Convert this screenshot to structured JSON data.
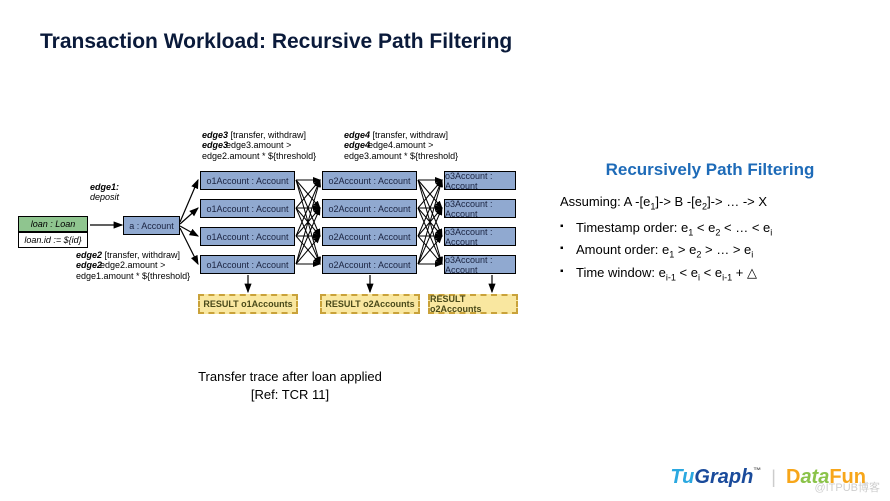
{
  "title": "Transaction Workload: Recursive Path Filtering",
  "diagram": {
    "loan": {
      "header": "loan : Loan",
      "value": "loan.id := ${id}"
    },
    "rootAccount": "a : Account",
    "col1": [
      "o1Account : Account",
      "o1Account : Account",
      "o1Account : Account",
      "o1Account : Account"
    ],
    "col2": [
      "o2Account : Account",
      "o2Account : Account",
      "o2Account : Account",
      "o2Account : Account"
    ],
    "col3": [
      "o3Account : Account",
      "o3Account : Account",
      "o3Account : Account",
      "o3Account : Account"
    ],
    "results": [
      "RESULT o1Accounts",
      "RESULT o2Accounts",
      "RESULT o2Accounts"
    ],
    "edge1": {
      "name": "edge1:",
      "desc": "deposit"
    },
    "edge2": {
      "name": "edge2",
      "desc1": "[transfer, withdraw]",
      "desc2": "edge2.amount >",
      "desc3": "edge1.amount * ${threshold}"
    },
    "edge3": {
      "name": "edge3",
      "desc1": "[transfer, withdraw]",
      "desc2": "edge3.amount >",
      "desc3": "edge2.amount * ${threshold}"
    },
    "edge4": {
      "name": "edge4",
      "desc1": "[transfer, withdraw]",
      "desc2": "edge4.amount >",
      "desc3": "edge3.amount * ${threshold}"
    }
  },
  "caption": {
    "line1": "Transfer trace after loan applied",
    "line2": "[Ref: TCR 11]"
  },
  "right": {
    "title": "Recursively Path Filtering",
    "assume": "Assuming: A -[e<sub>1</sub>]-> B -[e<sub>2</sub>]-> … -> X",
    "bullets": [
      "Timestamp order: e<sub>1</sub> < e<sub>2</sub> < … < e<sub>i</sub>",
      "Amount order: e<sub>1</sub> > e<sub>2</sub> > … > e<sub>i</sub>",
      "Time window: e<sub>i-1</sub> < e<sub>i</sub> < e<sub>i-1</sub> + △"
    ]
  },
  "footer": {
    "logo1": "TuGraph",
    "logo2": "DataFun",
    "watermark": "@ITPUB博客"
  }
}
